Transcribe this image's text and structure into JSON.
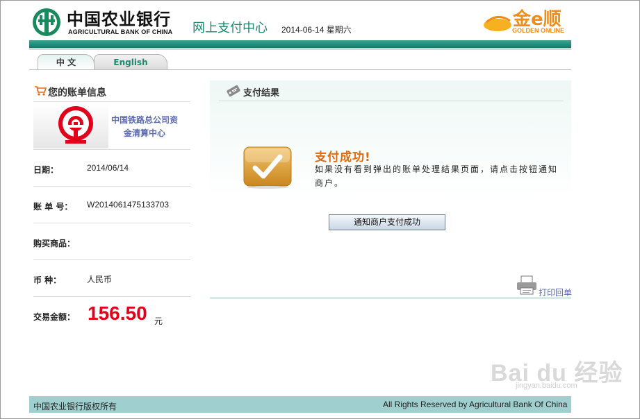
{
  "header": {
    "bank_name_cn": "中国农业银行",
    "bank_name_en": "AGRICULTURAL BANK OF CHINA",
    "center_title": "网上支付中心",
    "date": "2014-06-14 星期六",
    "golden_logo_text": "金e顺",
    "golden_logo_sub": "GOLDEN ONLINE"
  },
  "tabs": [
    {
      "label": "中 文",
      "active": true
    },
    {
      "label": "English",
      "active": false
    }
  ],
  "bill": {
    "title": "您的账单信息",
    "merchant_name": "中国铁路总公司资金清算中心",
    "fields": [
      {
        "label": "日期：",
        "value": "2014/06/14"
      },
      {
        "label": "账 单 号：",
        "value": "W2014061475133703"
      },
      {
        "label": "购买商品：",
        "value": ""
      },
      {
        "label": "币 种：",
        "value": "人民币"
      }
    ],
    "amount_label": "交易金额：",
    "amount": "156.50",
    "amount_unit": "元"
  },
  "result": {
    "title": "支付结果",
    "success_title": "支付成功!",
    "message": "如果没有看到弹出的账单处理结果页面，请点击按钮通知商户。",
    "notify_button": "通知商户支付成功",
    "print_link": "打印回单"
  },
  "footer": {
    "left": "中国农业银行版权所有",
    "right": "All Rights Reserved by Agricultural Bank Of China"
  },
  "watermark": {
    "logo": "Bai du 经验",
    "url": "jingyan.baidu.com"
  },
  "colors": {
    "brand_green": "#1b8a6d",
    "amount_red": "#e2001a",
    "success_orange": "#e06a10",
    "footer_bg": "#9fd0cf",
    "link_blue": "#5c6ab0"
  }
}
